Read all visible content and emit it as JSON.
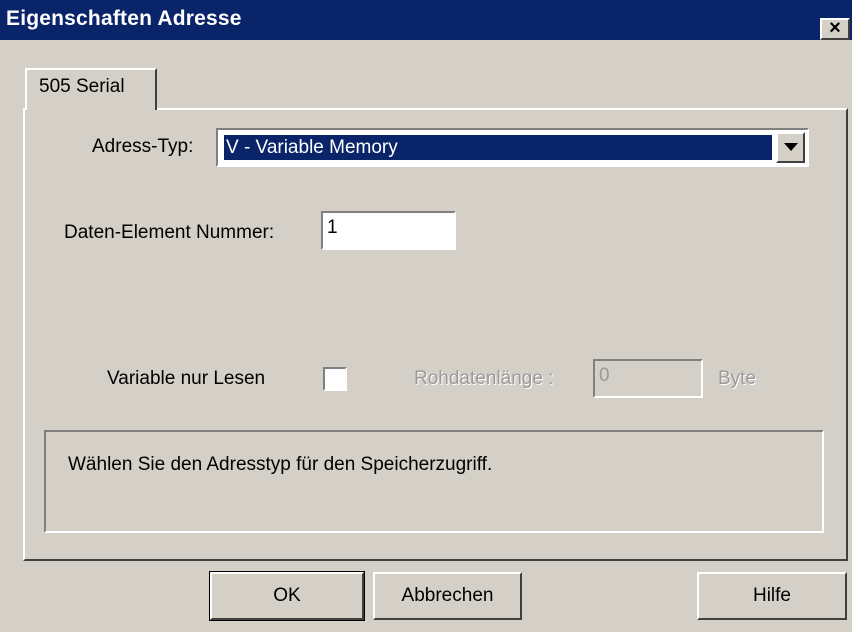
{
  "window": {
    "title": "Eigenschaften Adresse",
    "close_glyph": "×"
  },
  "tabs": [
    {
      "label": "505 Serial"
    }
  ],
  "form": {
    "address_type_label": "Adress-Typ:",
    "address_type_value": "V - Variable Memory",
    "data_element_label": "Daten-Element Nummer:",
    "data_element_value": "1",
    "read_only_label": "Variable nur Lesen",
    "read_only_checked": false,
    "raw_length_label": "Rohdatenlänge :",
    "raw_length_value": "0",
    "raw_length_unit": "Byte"
  },
  "info_text": "Wählen Sie den Adresstyp für den Speicherzugriff.",
  "buttons": {
    "ok": "OK",
    "cancel": "Abbrechen",
    "help": "Hilfe"
  },
  "icons": {
    "dropdown": "chevron-down-icon",
    "close": "close-icon"
  },
  "colors": {
    "titlebar": "#0a246a",
    "face": "#d4d0c8",
    "selection": "#0a246a"
  }
}
